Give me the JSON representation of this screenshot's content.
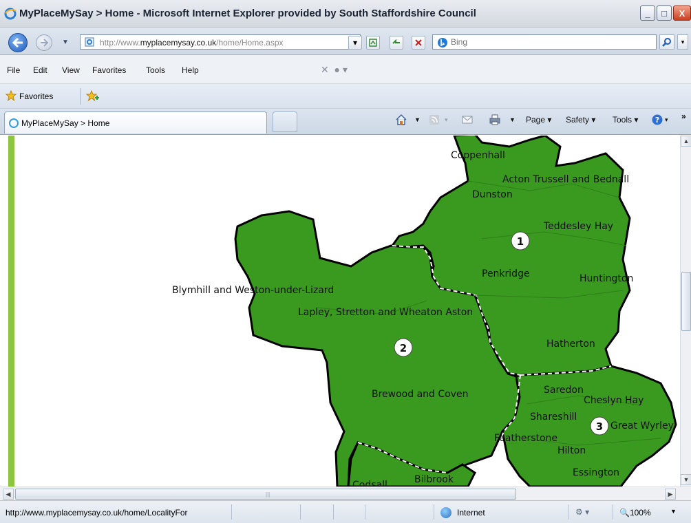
{
  "window": {
    "title": "MyPlaceMySay > Home - Microsoft Internet Explorer provided by South Staffordshire Council",
    "minimize_label": "_",
    "maximize_label": "□",
    "close_label": "X"
  },
  "address_bar": {
    "url_prefix": "http://www.",
    "url_domain": "myplacemysay.co.uk",
    "url_path": "/home/Home.aspx",
    "search_placeholder": "Bing"
  },
  "menu": {
    "items": [
      "File",
      "Edit",
      "View",
      "Favorites",
      "Tools",
      "Help"
    ]
  },
  "favorites_bar": {
    "label": "Favorites"
  },
  "tab": {
    "title": "MyPlaceMySay > Home"
  },
  "command_bar": {
    "page_label": "Page ▾",
    "safety_label": "Safety ▾",
    "tools_label": "Tools ▾",
    "more_label": "»"
  },
  "map": {
    "fill_color": "#3a9a1f",
    "border_color": "#000000",
    "stripe_color": "#8cc63e",
    "localities": {
      "coppenhall": "Coppenhall",
      "acton": "Acton Trussell and Bednall",
      "dunston": "Dunston",
      "teddesley": "Teddesley Hay",
      "penkridge": "Penkridge",
      "huntington": "Huntington",
      "blymhill": "Blymhill and Weston-under-Lizard",
      "lapley": "Lapley, Stretton and Wheaton Aston",
      "hatherton": "Hatherton",
      "brewood": "Brewood and Coven",
      "saredon": "Saredon",
      "cheslyn": "Cheslyn Hay",
      "shareshill": "Shareshill",
      "great_wyrley": "Great Wyrley",
      "featherstone": "Featherstone",
      "hilton": "Hilton",
      "essington": "Essington",
      "codsall": "Codsall",
      "bilbrook": "Bilbrook"
    },
    "markers": [
      "1",
      "2",
      "3"
    ]
  },
  "status_bar": {
    "status_text": "http://www.myplacemysay.co.uk/home/LocalityFor",
    "zone": "Internet",
    "zoom": "100%"
  }
}
